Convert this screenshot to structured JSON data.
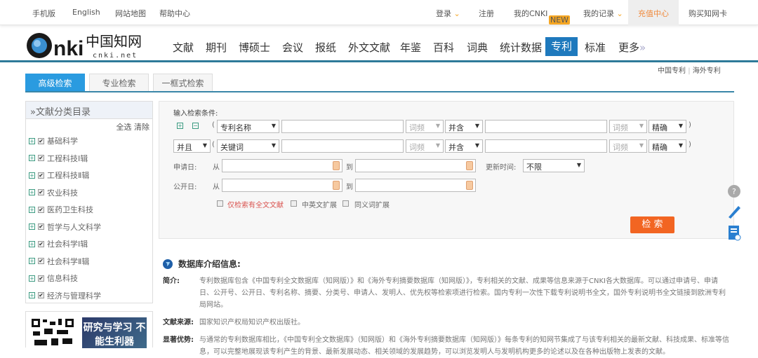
{
  "topbar": {
    "mobile": "手机版",
    "english": "English",
    "sitemap": "网站地图",
    "help": "帮助中心",
    "login": "登录",
    "register": "注册",
    "mycnki": "我的CNKI",
    "new_badge": "NEW",
    "records": "我的记录",
    "recharge": "充值中心",
    "buy_card": "购买知网卡"
  },
  "logo": {
    "text": "CNKI中国知网",
    "sub": "cnki.net"
  },
  "nav": [
    "文献",
    "期刊",
    "博硕士",
    "会议",
    "报纸",
    "外文文献",
    "年鉴",
    "百科",
    "词典",
    "统计数据",
    "专利",
    "标准",
    "更多"
  ],
  "sublinks": {
    "china": "中国专利",
    "sep": "|",
    "overseas": "海外专利"
  },
  "tabs": [
    "高级检索",
    "专业检索",
    "一框式检索"
  ],
  "sidebar": {
    "title": "»文献分类目录",
    "select_all": "全选",
    "clear": "清除",
    "categories": [
      "基础科学",
      "工程科技Ⅰ辑",
      "工程科技Ⅱ辑",
      "农业科技",
      "医药卫生科技",
      "哲学与人文科学",
      "社会科学Ⅰ辑",
      "社会科学Ⅱ辑",
      "信息科技",
      "经济与管理科学"
    ],
    "promo": "研究与学习 不能生利器"
  },
  "form": {
    "label": "输入检索条件:",
    "row1": {
      "field": "专利名称",
      "freq1": "词频",
      "op": "并含",
      "freq2": "词频",
      "match": "精确"
    },
    "row2": {
      "logic": "并且",
      "field": "关键词",
      "freq1": "词频",
      "op": "并含",
      "freq2": "词频",
      "match": "精确"
    },
    "apply_date": "申请日:",
    "pub_date": "公开日:",
    "from": "从",
    "to": "到",
    "update_time": "更新时间:",
    "update_value": "不限",
    "opt_fulltext": "仅检索有全文文献",
    "opt_cn_en": "中英文扩展",
    "opt_synonym": "同义词扩展",
    "search_button": "检 索"
  },
  "intro": {
    "title": "数据库介绍信息:",
    "summary_label": "简介:",
    "summary": "专利数据库包含《中国专利全文数据库（知网版）》和《海外专利摘要数据库（知网版）》，专利相关的文献、成果等信息来源于CNKI各大数据库。可以通过申请号、申请日、公开号、公开日、专利名称、摘要、分类号、申请人、发明人、优先权等检索项进行检索。国内专利一次性下载专利说明书全文，国外专利说明书全文链接到欧洲专利局网站。",
    "source_label": "文献来源:",
    "source": "国家知识产权局知识产权出版社。",
    "advantage_label": "显著优势:",
    "advantage": "与通常的专利数据库相比，《中国专利全文数据库》（知网版）和《海外专利摘要数据库（知网版）》每条专利的知网节集成了与该专利相关的最新文献、科技成果、标准等信息，可以完整地展现该专利产生的背景、最新发展动态、相关领域的发展趋势，可以浏览发明人与发明机构更多的论述以及在各种出版物上发表的文献。"
  }
}
